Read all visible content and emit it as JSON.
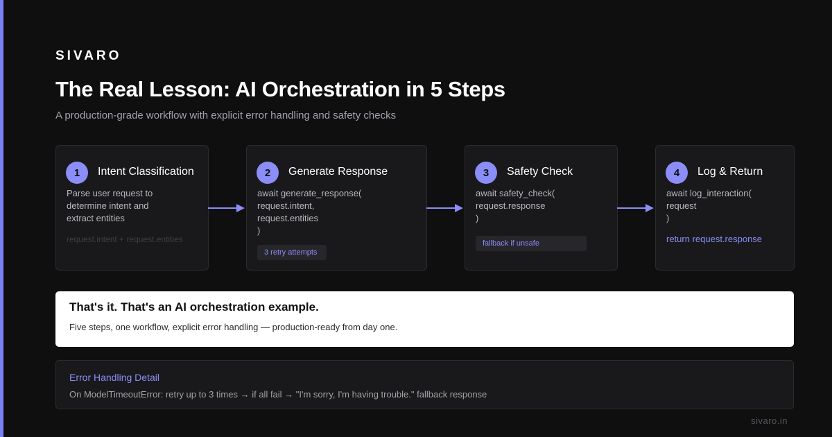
{
  "brand": "SIVARO",
  "title": "The Real Lesson: AI Orchestration in 5 Steps",
  "subtitle": "A production-grade workflow with explicit error handling and safety checks",
  "steps": [
    {
      "number": "1",
      "title": "Intent Classification",
      "lines": [
        "Parse user request to",
        "determine intent and",
        "extract entities"
      ],
      "footnote": "request.intent + request.entities"
    },
    {
      "number": "2",
      "title": "Generate Response",
      "lines": [
        "await generate_response(",
        "request.intent,",
        "request.entities",
        ")"
      ],
      "tag": "3 retry attempts"
    },
    {
      "number": "3",
      "title": "Safety Check",
      "lines": [
        "await safety_check(",
        "request.response",
        ")"
      ],
      "tag": "fallback if unsafe"
    },
    {
      "number": "4",
      "title": "Log & Return",
      "lines": [
        "await log_interaction(",
        "request",
        ")"
      ],
      "return_line": "return request.response"
    }
  ],
  "callout": {
    "title": "That's it. That's an AI orchestration example.",
    "text": "Five steps, one workflow, explicit error handling — production-ready from day one."
  },
  "error_handling": {
    "title": "Error Handling Detail",
    "text": "On ModelTimeoutError: retry up to 3 times → if all fail → \"I'm sorry, I'm having trouble.\" fallback response"
  },
  "footer": "sivaro.in",
  "colors": {
    "accent": "#8b8ef8",
    "background": "#0f0f10",
    "card": "#19191b"
  }
}
